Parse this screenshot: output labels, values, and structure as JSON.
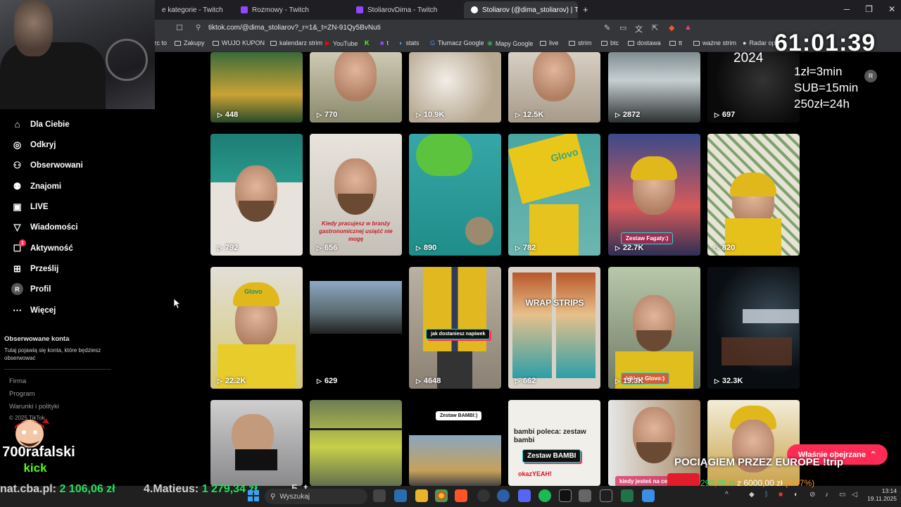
{
  "tabs": [
    {
      "label": "e kategorie - Twitch",
      "active": false
    },
    {
      "label": "Rozmowy - Twitch",
      "active": false
    },
    {
      "label": "StoliarovDima - Twitch",
      "active": false
    },
    {
      "label": "Stoliarov (@dima_stoliarov) | Tik",
      "active": true
    }
  ],
  "tab_controls": {
    "close": "✕",
    "new": "+"
  },
  "window_controls": {
    "minimize": "─",
    "maximize": "❐",
    "close": "✕"
  },
  "address": {
    "url": "tiktok.com/@dima_stoliarov?_r=1&_t=ZN-91Qy5BvNuti"
  },
  "bookmarks": [
    "zc to",
    "Zakupy",
    "WUJO KUPON",
    "kalendarz strim",
    "YouTube",
    "t",
    "stats",
    "Tłumacz Google",
    "Mapy Google",
    "live",
    "strim",
    "btc",
    "dostawa",
    "tt",
    "ważne strim",
    "Radar opa"
  ],
  "sidebar": {
    "items": [
      {
        "label": "Dla Ciebie",
        "icon": "home-icon",
        "glyph": "⌂"
      },
      {
        "label": "Odkryj",
        "icon": "compass-icon",
        "glyph": "◎"
      },
      {
        "label": "Obserwowani",
        "icon": "person-follow-icon",
        "glyph": "⚇"
      },
      {
        "label": "Znajomi",
        "icon": "friends-icon",
        "glyph": "⚉"
      },
      {
        "label": "LIVE",
        "icon": "live-icon",
        "glyph": "▣"
      },
      {
        "label": "Wiadomości",
        "icon": "message-icon",
        "glyph": "▽"
      },
      {
        "label": "Aktywność",
        "icon": "activity-icon",
        "glyph": "☐",
        "badge": "1"
      },
      {
        "label": "Prześlij",
        "icon": "upload-icon",
        "glyph": "⊞"
      },
      {
        "label": "Profil",
        "icon": "profile-icon",
        "glyph": "R"
      },
      {
        "label": "Więcej",
        "icon": "more-icon",
        "glyph": "⋯"
      }
    ],
    "followed_title": "Obserwowane konta",
    "followed_desc": "Tutaj pojawią się konta, które będziesz obserwować",
    "footer": [
      "Firma",
      "Program",
      "Warunki i polityki",
      "© 2025 TikTok"
    ]
  },
  "grid": {
    "rows": [
      [
        {
          "count": "448"
        },
        {
          "count": "770"
        },
        {
          "count": "10.9K"
        },
        {
          "count": "12.5K"
        },
        {
          "count": "2872"
        },
        {
          "count": "697"
        }
      ],
      [
        {
          "count": "792"
        },
        {
          "count": "656",
          "overlay": "Kiedy pracujesz w branży gastronomicznej usiąść nie mogę"
        },
        {
          "count": "890"
        },
        {
          "count": "782",
          "overlay": "Glovo"
        },
        {
          "count": "22.7K",
          "overlay": "Zestaw Fagaty:)"
        },
        {
          "count": "820"
        }
      ],
      [
        {
          "count": "22.2K",
          "overlay": "Glovo"
        },
        {
          "count": "629"
        },
        {
          "count": "4648",
          "overlay": "jak dostaniesz napiwek"
        },
        {
          "count": "662",
          "overlay": "WRAP STRIPS"
        },
        {
          "count": "19.3K",
          "overlay": "kiki na Glovo:)"
        },
        {
          "count": "32.3K"
        }
      ],
      [
        {
          "count": ""
        },
        {
          "count": ""
        },
        {
          "count": "",
          "overlay": "Zestaw BAMBI:)"
        },
        {
          "count": "",
          "overlay": "bambi poleca: zestaw bambi",
          "overlay2": "Zestaw BAMBI",
          "overlay3": "okazYEAH!"
        },
        {
          "count": "",
          "overlay": "kiedy jesteś na ce"
        },
        {
          "count": ""
        }
      ]
    ]
  },
  "stream": {
    "timer": "61:01:39",
    "year": "2024",
    "rates": [
      "1zł=3min",
      "SUB=15min",
      "250zł=24h"
    ],
    "avatar": "R",
    "watched_btn": "Właśnie obejrzane",
    "trip": "POCIĄGIEM PRZEZ EUROPE !trip",
    "goal_current": "292,25 zł",
    "goal_mid": " z ",
    "goal_target": "6000,00 zł",
    "goal_pct": "(4.87%)",
    "ticker1_a": "nat.cba.pl: ",
    "ticker1_b": "2 106,06 zł",
    "ticker2_a": "4.Matieus: ",
    "ticker2_b": "1 279,34 zł",
    "ticker3": "5. t",
    "logo_text": "700rafalski",
    "logo_sub": "kick"
  },
  "taskbar": {
    "search_placeholder": "Wyszukaj",
    "time": "13:14",
    "date": "19.11.2025"
  }
}
